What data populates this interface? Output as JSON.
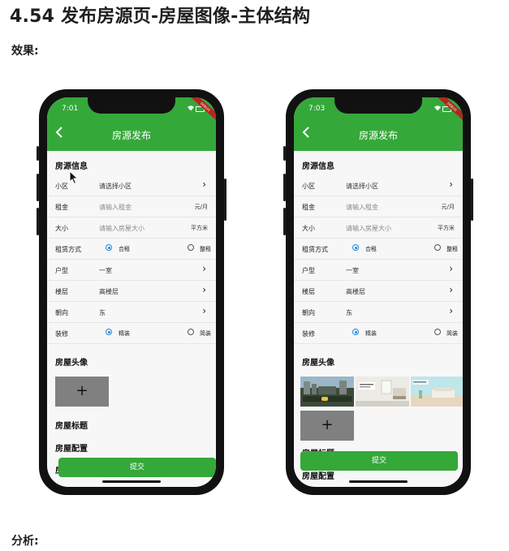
{
  "doc": {
    "title": "4.54 发布房源页-房屋图像-主体结构",
    "effect_label": "效果:",
    "analysis_label": "分析:"
  },
  "phones": [
    {
      "time": "7:01",
      "ribbon": "DEBUG",
      "nav_title": "房源发布",
      "sec_info": "房源信息",
      "community": {
        "label": "小区",
        "value": "请选择小区"
      },
      "rent": {
        "label": "租金",
        "placeholder": "请输入租金",
        "unit": "元/月"
      },
      "size": {
        "label": "大小",
        "placeholder": "请输入房屋大小",
        "unit": "平方米"
      },
      "rent_type": {
        "label": "租赁方式",
        "opt1": "合租",
        "opt2": "整租",
        "selected": "合租"
      },
      "layout": {
        "label": "户型",
        "value": "一室"
      },
      "floor": {
        "label": "楼层",
        "value": "高楼层"
      },
      "orientation": {
        "label": "朝向",
        "value": "东"
      },
      "decoration": {
        "label": "装修",
        "opt1": "精装",
        "opt2": "简装",
        "selected": "精装"
      },
      "sec_images": "房屋头像",
      "add_symbol": "+",
      "sec_title": "房屋标题",
      "sec_config": "房屋配置",
      "sec_partial": "房",
      "submit": "提交"
    },
    {
      "time": "7:03",
      "ribbon": "DEBUG",
      "nav_title": "房源发布",
      "sec_info": "房源信息",
      "community": {
        "label": "小区",
        "value": "请选择小区"
      },
      "rent": {
        "label": "租金",
        "placeholder": "请输入租金",
        "unit": "元/月"
      },
      "size": {
        "label": "大小",
        "placeholder": "请输入房屋大小",
        "unit": "平方米"
      },
      "rent_type": {
        "label": "租赁方式",
        "opt1": "合租",
        "opt2": "整租",
        "selected": "合租"
      },
      "layout": {
        "label": "户型",
        "value": "一室"
      },
      "floor": {
        "label": "楼层",
        "value": "高楼层"
      },
      "orientation": {
        "label": "朝向",
        "value": "东"
      },
      "decoration": {
        "label": "装修",
        "opt1": "精装",
        "opt2": "简装",
        "selected": "精装"
      },
      "sec_images": "房屋头像",
      "add_symbol": "+",
      "sec_title": "房屋标题",
      "sec_config": "房屋配置",
      "submit": "提交"
    }
  ],
  "colors": {
    "primary_green": "#35a83a",
    "radio_blue": "#1e88e5",
    "upload_gray": "#808080"
  }
}
